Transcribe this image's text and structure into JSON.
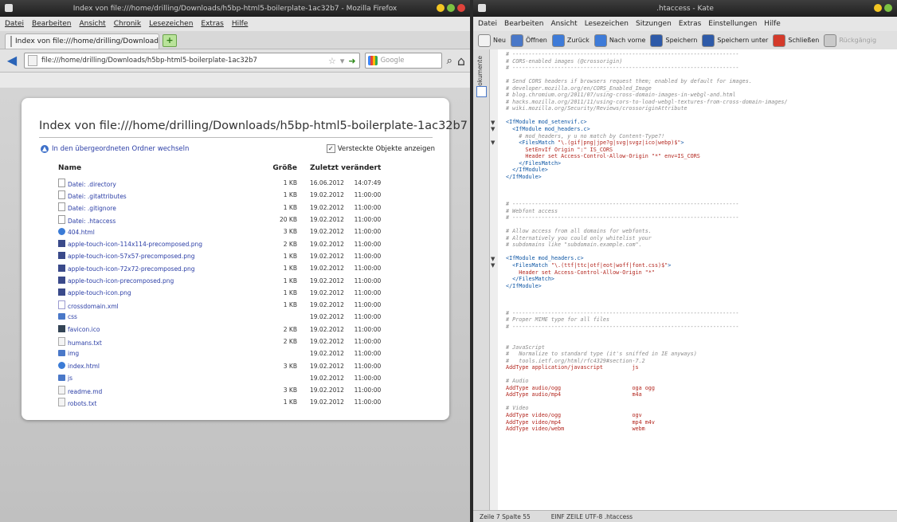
{
  "firefox": {
    "title": "Index von file:///home/drilling/Downloads/h5bp-html5-boilerplate-1ac32b7 - Mozilla Firefox",
    "menu": [
      "Datei",
      "Bearbeiten",
      "Ansicht",
      "Chronik",
      "Lesezeichen",
      "Extras",
      "Hilfe"
    ],
    "tab_label": "Index von file:///home/drilling/Downloads/...",
    "url": "file:///home/drilling/Downloads/h5bp-html5-boilerplate-1ac32b7",
    "search_placeholder": "Google",
    "page": {
      "heading": "Index von file:///home/drilling/Downloads/h5bp-html5-boilerplate-1ac32b7",
      "parent_link": "In den übergeordneten Ordner wechseln",
      "show_hidden": "Versteckte Objekte anzeigen",
      "columns": {
        "name": "Name",
        "size": "Größe",
        "modified": "Zuletzt verändert"
      },
      "files": [
        {
          "icon": "file",
          "name": "Datei: .directory",
          "size": "1 KB",
          "date": "16.06.2012",
          "time": "14:07:49"
        },
        {
          "icon": "file",
          "name": "Datei: .gitattributes",
          "size": "1 KB",
          "date": "19.02.2012",
          "time": "11:00:00"
        },
        {
          "icon": "file",
          "name": "Datei: .gitignore",
          "size": "1 KB",
          "date": "19.02.2012",
          "time": "11:00:00"
        },
        {
          "icon": "file",
          "name": "Datei: .htaccess",
          "size": "20 KB",
          "date": "19.02.2012",
          "time": "11:00:00"
        },
        {
          "icon": "html",
          "name": "404.html",
          "size": "3 KB",
          "date": "19.02.2012",
          "time": "11:00:00"
        },
        {
          "icon": "png",
          "name": "apple-touch-icon-114x114-precomposed.png",
          "size": "2 KB",
          "date": "19.02.2012",
          "time": "11:00:00"
        },
        {
          "icon": "png",
          "name": "apple-touch-icon-57x57-precomposed.png",
          "size": "1 KB",
          "date": "19.02.2012",
          "time": "11:00:00"
        },
        {
          "icon": "png",
          "name": "apple-touch-icon-72x72-precomposed.png",
          "size": "1 KB",
          "date": "19.02.2012",
          "time": "11:00:00"
        },
        {
          "icon": "png",
          "name": "apple-touch-icon-precomposed.png",
          "size": "1 KB",
          "date": "19.02.2012",
          "time": "11:00:00"
        },
        {
          "icon": "png",
          "name": "apple-touch-icon.png",
          "size": "1 KB",
          "date": "19.02.2012",
          "time": "11:00:00"
        },
        {
          "icon": "xml",
          "name": "crossdomain.xml",
          "size": "1 KB",
          "date": "19.02.2012",
          "time": "11:00:00"
        },
        {
          "icon": "folder",
          "name": "css",
          "size": "",
          "date": "19.02.2012",
          "time": "11:00:00"
        },
        {
          "icon": "ico",
          "name": "favicon.ico",
          "size": "2 KB",
          "date": "19.02.2012",
          "time": "11:00:00"
        },
        {
          "icon": "txt",
          "name": "humans.txt",
          "size": "2 KB",
          "date": "19.02.2012",
          "time": "11:00:00"
        },
        {
          "icon": "folder",
          "name": "img",
          "size": "",
          "date": "19.02.2012",
          "time": "11:00:00"
        },
        {
          "icon": "html",
          "name": "index.html",
          "size": "3 KB",
          "date": "19.02.2012",
          "time": "11:00:00"
        },
        {
          "icon": "folder",
          "name": "js",
          "size": "",
          "date": "19.02.2012",
          "time": "11:00:00"
        },
        {
          "icon": "txt",
          "name": "readme.md",
          "size": "3 KB",
          "date": "19.02.2012",
          "time": "11:00:00"
        },
        {
          "icon": "txt",
          "name": "robots.txt",
          "size": "1 KB",
          "date": "19.02.2012",
          "time": "11:00:00"
        }
      ]
    }
  },
  "kate": {
    "title": ".htaccess - Kate",
    "menu": [
      "Datei",
      "Bearbeiten",
      "Ansicht",
      "Lesezeichen",
      "Sitzungen",
      "Extras",
      "Einstellungen",
      "Hilfe"
    ],
    "toolbar": [
      {
        "label": "Neu",
        "color": "#f2f2f2"
      },
      {
        "label": "Öffnen",
        "color": "#4a78c8"
      },
      {
        "label": "Zurück",
        "color": "#3e7bd8"
      },
      {
        "label": "Nach vorne",
        "color": "#3e7bd8"
      },
      {
        "label": "Speichern",
        "color": "#2e5aa8"
      },
      {
        "label": "Speichern unter",
        "color": "#2e5aa8"
      },
      {
        "label": "Schließen",
        "color": "#d43a2a"
      },
      {
        "label": "Rückgängig",
        "color": "#c9c9c9",
        "disabled": true
      }
    ],
    "sidebar_label": "Dokumente",
    "code_lines": [
      [
        {
          "c": "c",
          "t": "# ----------------------------------------------------------------------"
        }
      ],
      [
        {
          "c": "c",
          "t": "# CORS-enabled images (@crossorigin)"
        }
      ],
      [
        {
          "c": "c",
          "t": "# ----------------------------------------------------------------------"
        }
      ],
      [],
      [
        {
          "c": "c",
          "t": "# Send CORS headers if browsers request them; enabled by default for images."
        }
      ],
      [
        {
          "c": "c",
          "t": "# developer.mozilla.org/en/CORS_Enabled_Image"
        }
      ],
      [
        {
          "c": "c",
          "t": "# blog.chromium.org/2011/07/using-cross-domain-images-in-webgl-and.html"
        }
      ],
      [
        {
          "c": "c",
          "t": "# hacks.mozilla.org/2011/11/using-cors-to-load-webgl-textures-from-cross-domain-images/"
        }
      ],
      [
        {
          "c": "c",
          "t": "# wiki.mozilla.org/Security/Reviews/crossoriginAttribute"
        }
      ],
      [],
      [
        {
          "c": "t",
          "t": "<IfModule mod_setenvif.c>"
        }
      ],
      [
        {
          "c": "k",
          "t": "  "
        },
        {
          "c": "t",
          "t": "<IfModule mod_headers.c>"
        }
      ],
      [
        {
          "c": "c",
          "t": "    # mod_headers, y u no match by Content-Type?!"
        }
      ],
      [
        {
          "c": "k",
          "t": "    "
        },
        {
          "c": "t",
          "t": "<FilesMatch "
        },
        {
          "c": "s",
          "t": "\"\\.(gif|png|jpe?g|svg|svgz|ico|webp)$\""
        },
        {
          "c": "t",
          "t": ">"
        }
      ],
      [
        {
          "c": "k",
          "t": "      "
        },
        {
          "c": "s",
          "t": "SetEnvIf Origin \":\" IS_CORS"
        }
      ],
      [
        {
          "c": "k",
          "t": "      "
        },
        {
          "c": "s",
          "t": "Header set Access-Control-Allow-Origin \"*\" env=IS_CORS"
        }
      ],
      [
        {
          "c": "k",
          "t": "    "
        },
        {
          "c": "t",
          "t": "</FilesMatch>"
        }
      ],
      [
        {
          "c": "k",
          "t": "  "
        },
        {
          "c": "t",
          "t": "</IfModule>"
        }
      ],
      [
        {
          "c": "t",
          "t": "</IfModule>"
        }
      ],
      [],
      [],
      [],
      [
        {
          "c": "c",
          "t": "# ----------------------------------------------------------------------"
        }
      ],
      [
        {
          "c": "c",
          "t": "# Webfont access"
        }
      ],
      [
        {
          "c": "c",
          "t": "# ----------------------------------------------------------------------"
        }
      ],
      [],
      [
        {
          "c": "c",
          "t": "# Allow access from all domains for webfonts."
        }
      ],
      [
        {
          "c": "c",
          "t": "# Alternatively you could only whitelist your"
        }
      ],
      [
        {
          "c": "c",
          "t": "# subdomains like \"subdomain.example.com\"."
        }
      ],
      [],
      [
        {
          "c": "t",
          "t": "<IfModule mod_headers.c>"
        }
      ],
      [
        {
          "c": "k",
          "t": "  "
        },
        {
          "c": "t",
          "t": "<FilesMatch "
        },
        {
          "c": "s",
          "t": "\"\\.(ttf|ttc|otf|eot|woff|font.css)$\""
        },
        {
          "c": "t",
          "t": ">"
        }
      ],
      [
        {
          "c": "k",
          "t": "    "
        },
        {
          "c": "s",
          "t": "Header set Access-Control-Allow-Origin \"*\""
        }
      ],
      [
        {
          "c": "k",
          "t": "  "
        },
        {
          "c": "t",
          "t": "</FilesMatch>"
        }
      ],
      [
        {
          "c": "t",
          "t": "</IfModule>"
        }
      ],
      [],
      [],
      [],
      [
        {
          "c": "c",
          "t": "# ----------------------------------------------------------------------"
        }
      ],
      [
        {
          "c": "c",
          "t": "# Proper MIME type for all files"
        }
      ],
      [
        {
          "c": "c",
          "t": "# ----------------------------------------------------------------------"
        }
      ],
      [],
      [],
      [
        {
          "c": "c",
          "t": "# JavaScript"
        }
      ],
      [
        {
          "c": "c",
          "t": "#   Normalize to standard type (it's sniffed in IE anyways)"
        }
      ],
      [
        {
          "c": "c",
          "t": "#   tools.ietf.org/html/rfc4329#section-7.2"
        }
      ],
      [
        {
          "c": "s",
          "t": "AddType application/javascript         js"
        }
      ],
      [],
      [
        {
          "c": "c",
          "t": "# Audio"
        }
      ],
      [
        {
          "c": "s",
          "t": "AddType audio/ogg                      oga ogg"
        }
      ],
      [
        {
          "c": "s",
          "t": "AddType audio/mp4                      m4a"
        }
      ],
      [],
      [
        {
          "c": "c",
          "t": "# Video"
        }
      ],
      [
        {
          "c": "s",
          "t": "AddType video/ogg                      ogv"
        }
      ],
      [
        {
          "c": "s",
          "t": "AddType video/mp4                      mp4 m4v"
        }
      ],
      [
        {
          "c": "s",
          "t": "AddType video/webm                     webm"
        }
      ]
    ],
    "fold_markers": [
      10,
      11,
      13,
      30,
      31
    ],
    "status": {
      "position": "Zeile 7 Spalte 55",
      "mode": "EINF",
      "line_mode": "ZEILE",
      "encoding": "UTF-8",
      "file": ".htaccess"
    }
  }
}
